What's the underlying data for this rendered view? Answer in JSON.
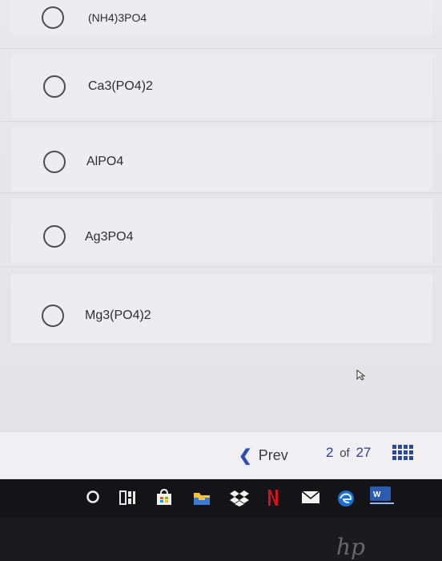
{
  "options": [
    {
      "label": "(NH4)3PO4"
    },
    {
      "label": "Ca3(PO4)2"
    },
    {
      "label": "AlPO4"
    },
    {
      "label": "Ag3PO4"
    },
    {
      "label": "Mg3(PO4)2"
    }
  ],
  "footer": {
    "prev_label": "Prev",
    "current": "2",
    "of_label": "of",
    "total": "27"
  },
  "taskbar": {
    "icons": [
      "start-circle-icon",
      "task-view-icon",
      "store-icon",
      "file-explorer-icon",
      "dropbox-icon",
      "netflix-icon",
      "mail-icon",
      "edge-icon",
      "word-icon"
    ]
  },
  "colors": {
    "accent": "#2b48a0",
    "background": "#e9e9ee",
    "taskbar": "#141418"
  },
  "brand": {
    "hp_logo": "hp"
  }
}
